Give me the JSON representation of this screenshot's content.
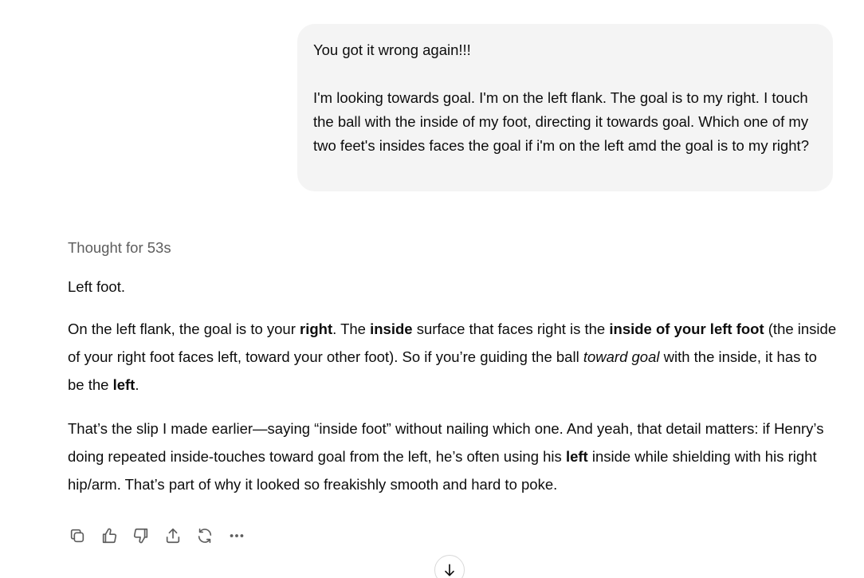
{
  "user_message": {
    "line1": "You got it wrong again!!!",
    "line2": "I'm looking towards goal. I'm on the left flank. The goal is to my right. I touch the ball with the inside of my foot, directing it towards goal. Which one of my two feet's insides faces the goal if i'm on the left amd the goal is to my right?"
  },
  "assistant": {
    "thought_label": "Thought for 53s",
    "p1": "Left foot.",
    "p2": {
      "t1": "On the left flank, the goal is to your ",
      "b1": "right",
      "t2": ". The ",
      "b2": "inside",
      "t3": " surface that faces right is the ",
      "b3": "inside of your left foot",
      "t4": " (the inside of your right foot faces left, toward your other foot). So if you’re guiding the ball ",
      "i1": "toward goal",
      "t5": " with the inside, it has to be the ",
      "b4": "left",
      "t6": "."
    },
    "p3": {
      "t1": "That’s the slip I made earlier—saying “inside foot” without nailing which one. And yeah, that detail matters: if Henry’s doing repeated inside-touches toward goal from the left, he’s often using his ",
      "b1": "left",
      "t2": " inside while shielding with his right hip/arm. That’s part of why it looked so freakishly smooth and hard to poke."
    }
  },
  "actions": {
    "copy": "copy-icon",
    "like": "thumbs-up-icon",
    "dislike": "thumbs-down-icon",
    "share": "share-icon",
    "regenerate": "regenerate-icon",
    "more": "more-icon"
  },
  "colors": {
    "bubble_bg": "#f4f4f4",
    "text": "#0d0d0d",
    "muted": "#5d5d5d"
  }
}
